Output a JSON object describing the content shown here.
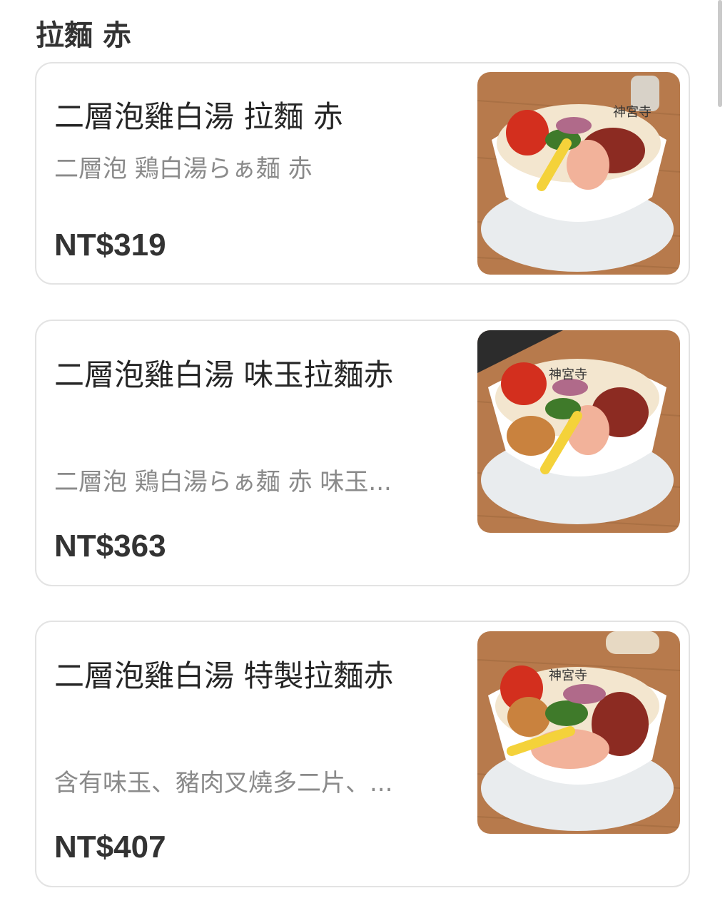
{
  "section": {
    "title": "拉麵 赤"
  },
  "items": [
    {
      "name": "二層泡雞白湯 拉麵 赤",
      "description": "二層泡 鶏白湯らぁ麺 赤",
      "price": "NT$319",
      "photo_icon": "ramen-bowl-photo",
      "bowl_text": "神宮寺"
    },
    {
      "name": "二層泡雞白湯 味玉拉麵赤",
      "description": "二層泡 鶏白湯らぁ麺 赤 味玉...",
      "price": "NT$363",
      "photo_icon": "ramen-bowl-egg-photo",
      "bowl_text": "神宮寺"
    },
    {
      "name": "二層泡雞白湯 特製拉麵赤",
      "description": "含有味玉、豬肉叉燒多二片、...",
      "price": "NT$407",
      "photo_icon": "ramen-bowl-special-photo",
      "bowl_text": "神宮寺"
    }
  ],
  "colors": {
    "text": "#262626",
    "muted": "#8a8a8a",
    "border": "#e3e3e3"
  }
}
